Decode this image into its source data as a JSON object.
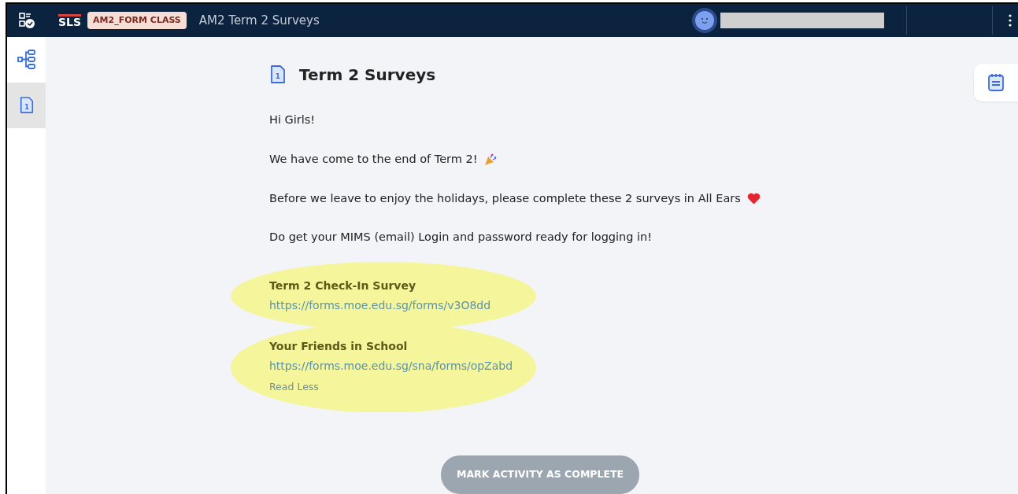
{
  "topbar": {
    "logo": "SLS",
    "class_badge": "AM2_FORM CLASS",
    "title": "AM2 Term 2 Surveys"
  },
  "sidebar": {
    "items": [
      {
        "kind": "outline",
        "selected": false
      },
      {
        "kind": "page",
        "label": "1",
        "selected": true
      }
    ]
  },
  "activity": {
    "page_number": "1",
    "title": "Term 2 Surveys",
    "paragraphs": [
      {
        "text": "Hi Girls!"
      },
      {
        "kind": "party",
        "text": "We have come to the end of Term 2!"
      },
      {
        "kind": "heart",
        "text": "Before we leave to enjoy the holidays, please complete these 2 surveys in All Ears"
      },
      {
        "text": "Do get your MIMS (email) Login and password ready for logging in!"
      }
    ],
    "surveys": [
      {
        "name": "Term 2 Check-In Survey",
        "link": "https://forms.moe.edu.sg/forms/v3O8dd"
      },
      {
        "name": "Your Friends in School",
        "link": "https://forms.moe.edu.sg/sna/forms/opZabd"
      }
    ],
    "read_less": "Read Less",
    "complete_button": "MARK ACTIVITY AS COMPLETE"
  }
}
